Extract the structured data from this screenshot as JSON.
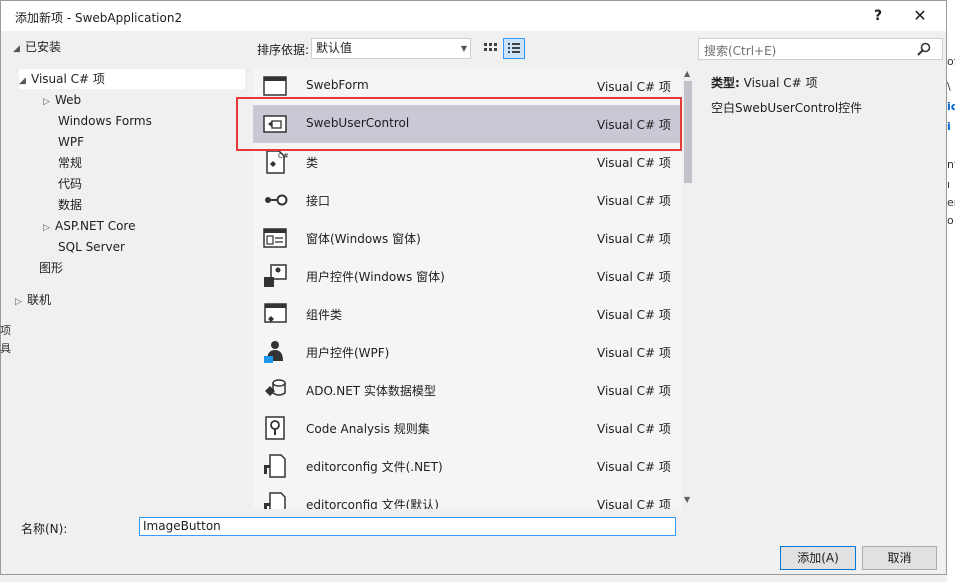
{
  "window": {
    "title": "添加新项 - SwebApplication2",
    "help_label": "?",
    "close_label": "✕"
  },
  "tree": {
    "installed": "已安装",
    "visual_csharp": "Visual C# 项",
    "web": "Web",
    "windows_forms": "Windows Forms",
    "wpf": "WPF",
    "general": "常规",
    "code": "代码",
    "data": "数据",
    "aspnet_core": "ASP.NET Core",
    "sql_server": "SQL Server",
    "graphics": "图形",
    "online": "联机"
  },
  "toolbar": {
    "sort_label": "排序依据:",
    "sort_value": "默认值",
    "search_placeholder": "搜索(Ctrl+E)"
  },
  "items": [
    {
      "name": "SwebForm",
      "type": "Visual C# 项",
      "icon": "form-icon"
    },
    {
      "name": "SwebUserControl",
      "type": "Visual C# 项",
      "icon": "user-control-icon"
    },
    {
      "name": "类",
      "type": "Visual C# 项",
      "icon": "class-file-icon"
    },
    {
      "name": "接口",
      "type": "Visual C# 项",
      "icon": "interface-icon"
    },
    {
      "name": "窗体(Windows 窗体)",
      "type": "Visual C# 项",
      "icon": "windows-form-icon"
    },
    {
      "name": "用户控件(Windows 窗体)",
      "type": "Visual C# 项",
      "icon": "windows-user-control-icon"
    },
    {
      "name": "组件类",
      "type": "Visual C# 项",
      "icon": "component-class-icon"
    },
    {
      "name": "用户控件(WPF)",
      "type": "Visual C# 项",
      "icon": "wpf-user-control-icon"
    },
    {
      "name": "ADO.NET 实体数据模型",
      "type": "Visual C# 项",
      "icon": "entity-model-icon"
    },
    {
      "name": "Code Analysis 规则集",
      "type": "Visual C# 项",
      "icon": "ruleset-icon"
    },
    {
      "name": "editorconfig 文件(.NET)",
      "type": "Visual C# 项",
      "icon": "editorconfig-icon"
    },
    {
      "name": "editorconfig 文件(默认)",
      "type": "Visual C# 项",
      "icon": "editorconfig-default-icon"
    }
  ],
  "detail": {
    "type_label": "类型:",
    "type_value": "Visual C# 项",
    "description": "空白SwebUserControl控件"
  },
  "footer": {
    "name_label": "名称(N):",
    "name_value": "ImageButton",
    "add_label": "添加(A)",
    "cancel_label": "取消"
  },
  "background": {
    "right_fragments": [
      "oft",
      "\\",
      "ic",
      "i",
      "nf",
      "ı",
      "er",
      "o"
    ],
    "left_fragments": [
      "项",
      "具"
    ]
  },
  "colors": {
    "selection": "#c9c9d6",
    "highlight_border": "#e53935",
    "accent": "#0078d7"
  }
}
